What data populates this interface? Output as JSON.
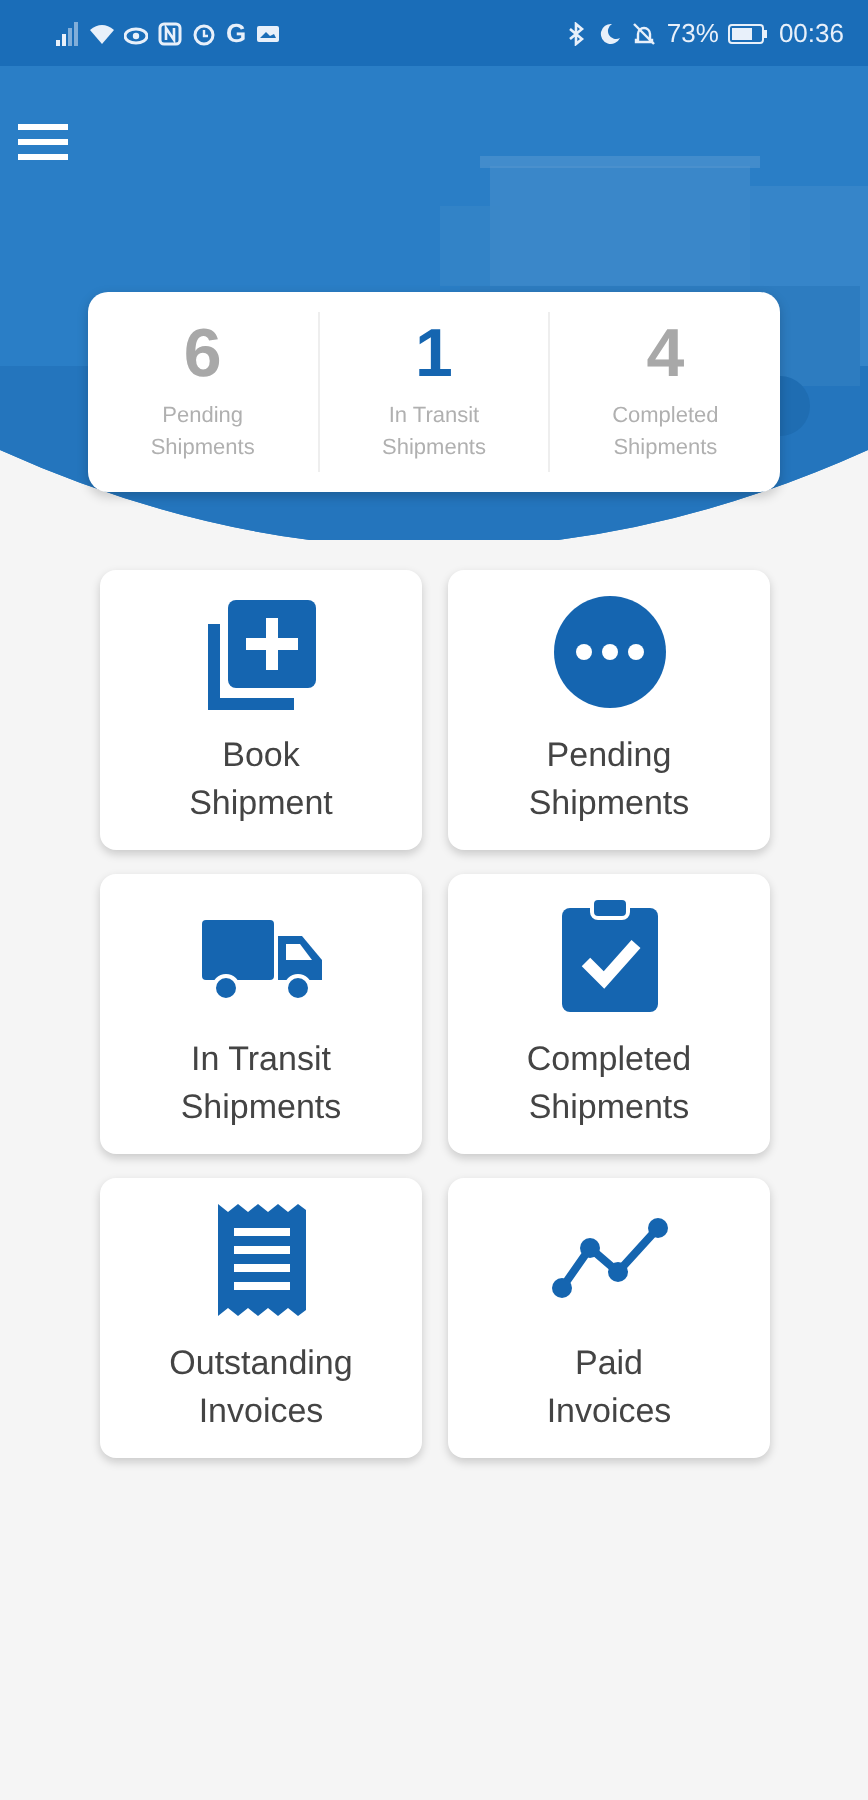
{
  "status_bar": {
    "left_text": "G",
    "battery": "73%",
    "time": "00:36"
  },
  "stats": [
    {
      "value": "6",
      "label": "Pending\nShipments",
      "selected": false
    },
    {
      "value": "1",
      "label": "In Transit\nShipments",
      "selected": true
    },
    {
      "value": "4",
      "label": "Completed\nShipments",
      "selected": false
    }
  ],
  "tiles": [
    {
      "kind": "book",
      "label": "Book\nShipment"
    },
    {
      "kind": "pending",
      "label": "Pending\nShipments"
    },
    {
      "kind": "transit",
      "label": "In Transit\nShipments"
    },
    {
      "kind": "completed",
      "label": "Completed\nShipments"
    },
    {
      "kind": "receipt",
      "label": "Outstanding\nInvoices"
    },
    {
      "kind": "trend",
      "label": "Paid\nInvoices"
    }
  ]
}
